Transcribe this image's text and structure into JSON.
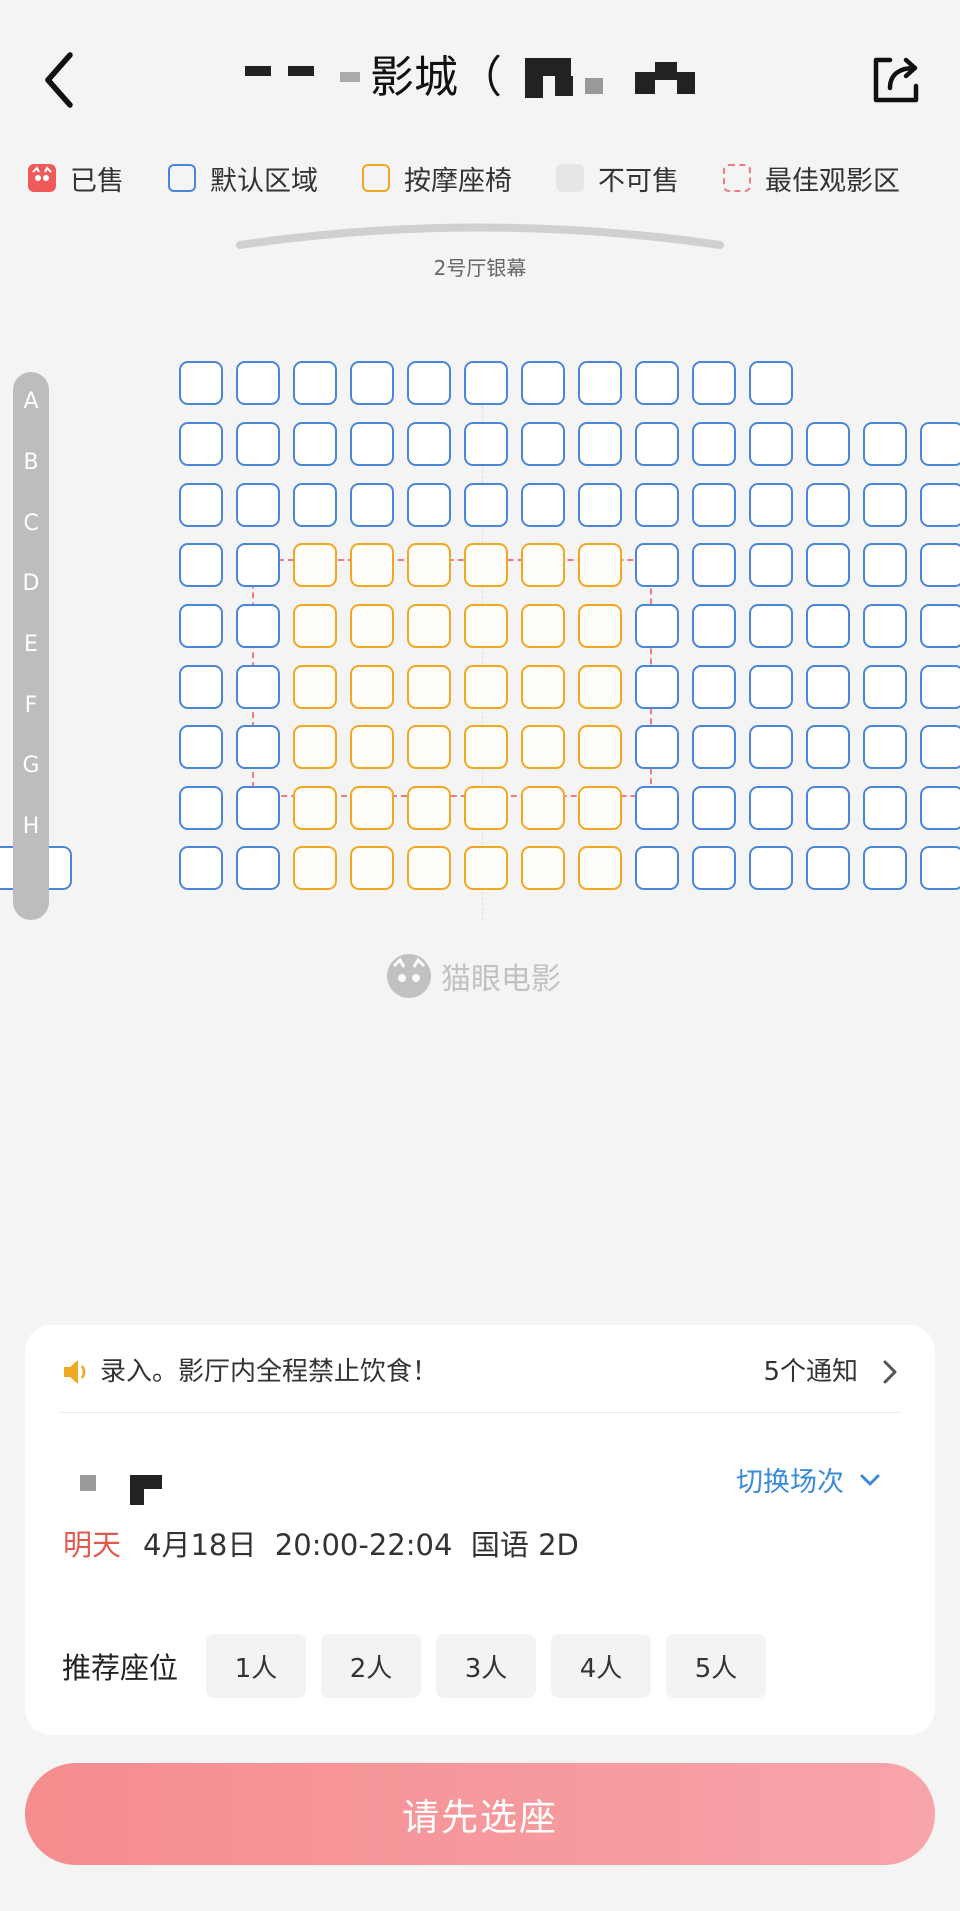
{
  "header": {
    "title_visible": "影城（",
    "back_icon": "chevron-left-icon",
    "share_icon": "share-icon"
  },
  "legend": [
    {
      "label": "已售",
      "icon": "sold-cat-icon",
      "color": "#f05a5a"
    },
    {
      "label": "默认区域",
      "icon": "default-seat-icon",
      "color": "#4a86d8"
    },
    {
      "label": "按摩座椅",
      "icon": "massage-seat-icon",
      "color": "#f0a822"
    },
    {
      "label": "不可售",
      "icon": "unavailable-seat-icon",
      "color": "#e6e6e6"
    },
    {
      "label": "最佳观影区",
      "icon": "best-zone-icon",
      "color": "#f07a80"
    }
  ],
  "screen": {
    "label": "2号厅银幕"
  },
  "rows": [
    "A",
    "B",
    "C",
    "D",
    "E",
    "F",
    "G",
    "H"
  ],
  "watermark": {
    "text": "猫眼电影",
    "icon": "maoyan-cat-icon"
  },
  "notice": {
    "icon": "speaker-icon",
    "text": "录入。影厅内全程禁止饮食！",
    "count": "5个通知",
    "arrow_icon": "chevron-right-icon"
  },
  "showtime": {
    "switch_label": "切换场次",
    "switch_icon": "chevron-down-icon",
    "day": "明天",
    "info": "4月18日  20:00-22:04  国语 2D"
  },
  "recommend": {
    "label": "推荐座位",
    "options": [
      "1人",
      "2人",
      "3人",
      "4人",
      "5人"
    ]
  },
  "action": {
    "label": "请先选座"
  },
  "colors": {
    "accent_blue": "#4a86d8",
    "massage_orange": "#f0a822",
    "best_zone_red": "#f07a80",
    "button_pink": "#f58c8e"
  }
}
